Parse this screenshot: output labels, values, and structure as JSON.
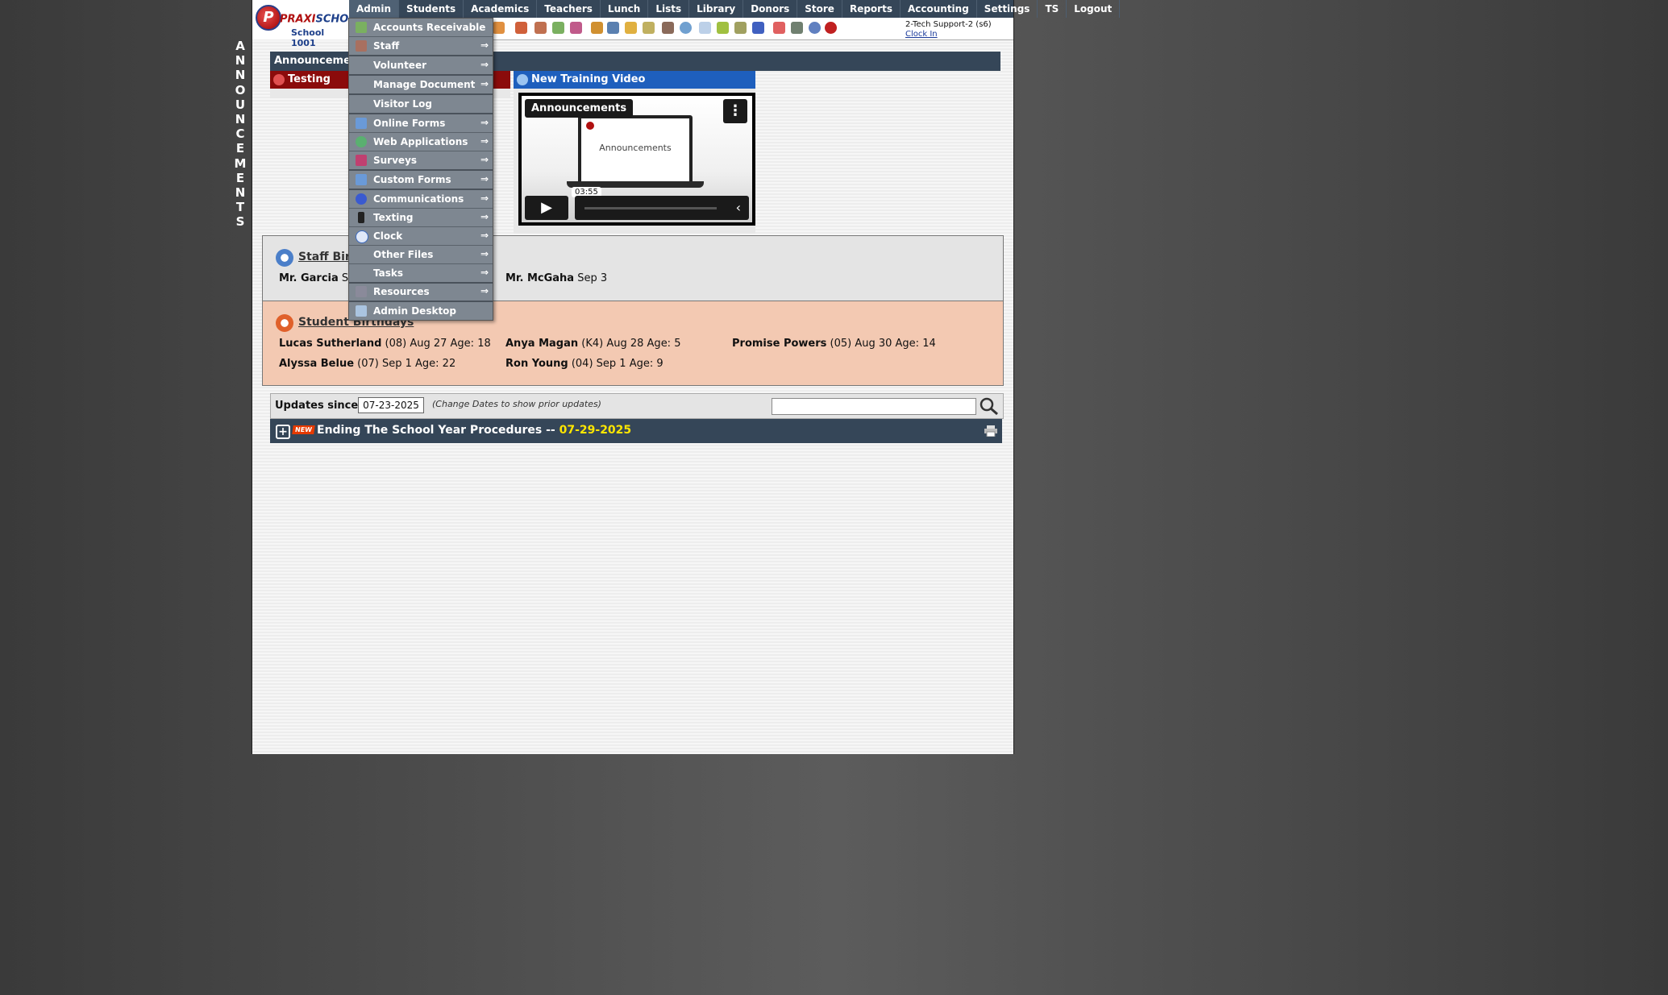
{
  "side_label": [
    "A",
    "N",
    "N",
    "O",
    "U",
    "N",
    "C",
    "E",
    "M",
    "E",
    "N",
    "T",
    "S"
  ],
  "logo": {
    "mark": "P",
    "brand_a": "PRAXI",
    "brand_b": "SCHOOL",
    "tm": "™",
    "school": "School 1001"
  },
  "nav": [
    "Admin",
    "Students",
    "Academics",
    "Teachers",
    "Lunch",
    "Lists",
    "Library",
    "Donors",
    "Store",
    "Reports",
    "Accounting",
    "Settings",
    "TS",
    "Logout"
  ],
  "user": {
    "name": "2-Tech Support-2 (s6)",
    "clock_in": "Clock In"
  },
  "announcements": {
    "bar_title": "Announcements",
    "testing": "Testing",
    "video_panel": "New Training Video"
  },
  "video": {
    "title": "Announcements",
    "screen_label": "Announcements",
    "time": "03:55",
    "menu_glyph": "⋮",
    "play_glyph": "▶",
    "chev_glyph": "‹"
  },
  "staff_birthdays": {
    "title": "Staff Birthdays",
    "entries": [
      {
        "name": "Mr. Garcia",
        "detail": "Sep"
      },
      {
        "name": "Mr. McGaha",
        "detail": "Sep 3"
      }
    ]
  },
  "student_birthdays": {
    "title": "Student Birthdays",
    "entries": [
      {
        "name": "Lucas Sutherland",
        "detail": "(08) Aug 27 Age: 18"
      },
      {
        "name": "Anya Magan",
        "detail": "(K4) Aug 28 Age: 5"
      },
      {
        "name": "Promise Powers",
        "detail": "(05) Aug 30 Age: 14"
      },
      {
        "name": "Alyssa Belue",
        "detail": "(07) Sep 1 Age: 22"
      },
      {
        "name": "Ron Young",
        "detail": "(04) Sep 1 Age: 9"
      }
    ]
  },
  "updates": {
    "label": "Updates since:",
    "date": "07-23-2025",
    "hint": "(Change Dates to show prior updates)",
    "search_value": ""
  },
  "procedure": {
    "new_badge": "NEW",
    "title": "Ending The School Year Procedures -- ",
    "date": "07-29-2025",
    "plus": "+"
  },
  "admin_menu": [
    {
      "label": "Accounts Receivable",
      "icon": "money-icon",
      "submenu": false
    },
    {
      "label": "Staff",
      "icon": "staff-icon",
      "submenu": true
    },
    {
      "label": "Volunteer",
      "icon": "",
      "submenu": true
    },
    {
      "label": "Manage Document",
      "icon": "",
      "submenu": true
    },
    {
      "label": "Visitor Log",
      "icon": "",
      "submenu": false
    },
    {
      "label": "Online Forms",
      "icon": "forms-icon",
      "submenu": true
    },
    {
      "label": "Web Applications",
      "icon": "globe-icon",
      "submenu": true
    },
    {
      "label": "Surveys",
      "icon": "survey-icon",
      "submenu": true
    },
    {
      "label": "Custom Forms",
      "icon": "forms-icon",
      "submenu": true
    },
    {
      "label": "Communications",
      "icon": "at-icon",
      "submenu": true
    },
    {
      "label": "Texting",
      "icon": "phone-icon",
      "submenu": true
    },
    {
      "label": "Clock",
      "icon": "clock-icon",
      "submenu": true
    },
    {
      "label": "Other Files",
      "icon": "",
      "submenu": true
    },
    {
      "label": "Tasks",
      "icon": "",
      "submenu": true
    },
    {
      "label": "Resources",
      "icon": "calculator-icon",
      "submenu": true
    },
    {
      "label": "Admin Desktop",
      "icon": "desktop-icon",
      "submenu": false
    }
  ],
  "submenu_arrow": "⇒"
}
